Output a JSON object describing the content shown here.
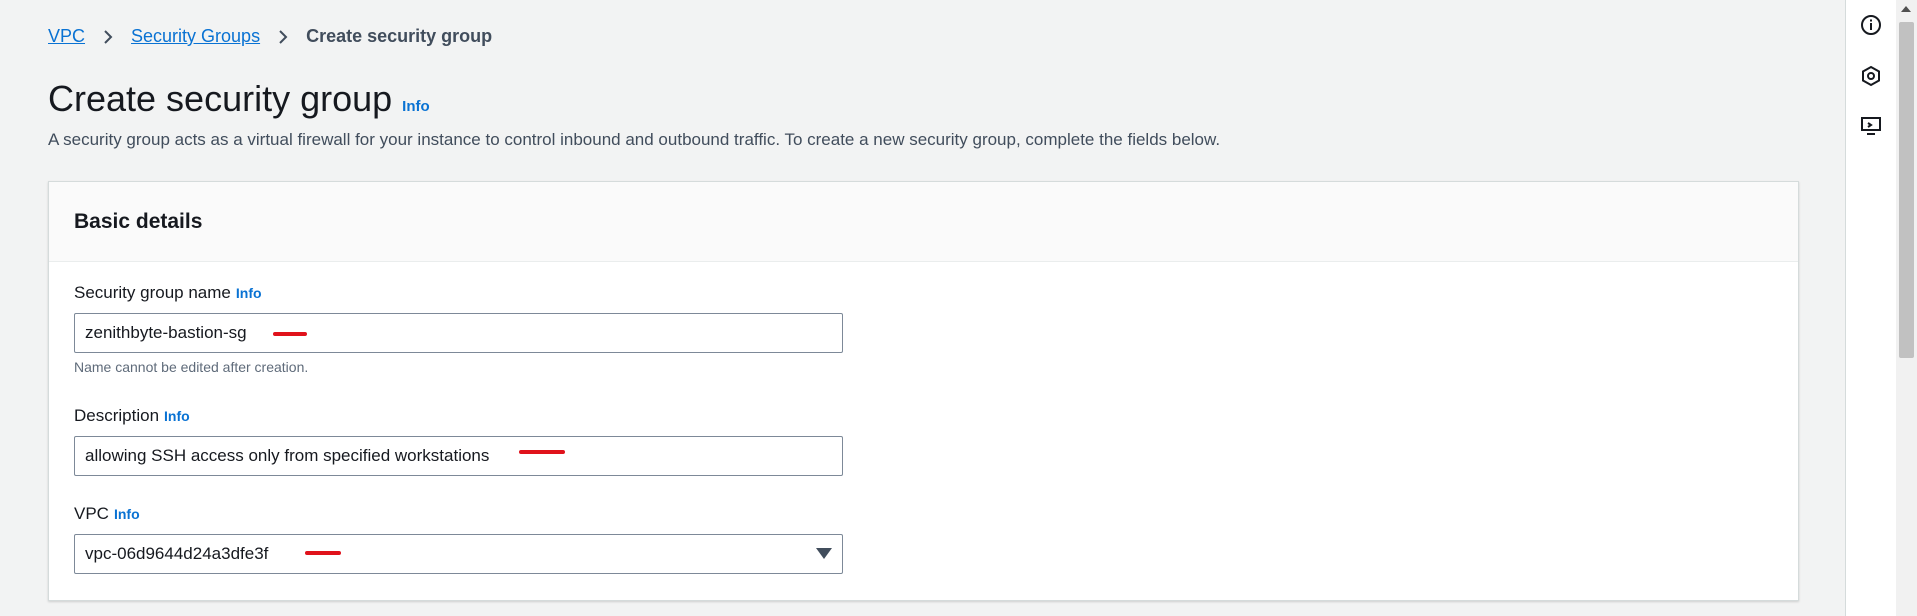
{
  "breadcrumb": {
    "items": [
      {
        "label": "VPC"
      },
      {
        "label": "Security Groups"
      }
    ],
    "current": "Create security group"
  },
  "page": {
    "title": "Create security group",
    "info": "Info",
    "description": "A security group acts as a virtual firewall for your instance to control inbound and outbound traffic. To create a new security group, complete the fields below."
  },
  "basic_details": {
    "title": "Basic details",
    "name_field": {
      "label": "Security group name",
      "info": "Info",
      "value": "zenithbyte-bastion-sg",
      "hint": "Name cannot be edited after creation."
    },
    "description_field": {
      "label": "Description",
      "info": "Info",
      "value": "allowing SSH access only from specified workstations"
    },
    "vpc_field": {
      "label": "VPC",
      "info": "Info",
      "value": "vpc-06d9644d24a3dfe3f"
    }
  },
  "colors": {
    "link": "#0972d3",
    "annotation": "#e0121b",
    "background": "#f2f3f3"
  },
  "rail_icons": [
    "info-icon",
    "settings-hexagon-icon",
    "feedback-screen-icon"
  ]
}
